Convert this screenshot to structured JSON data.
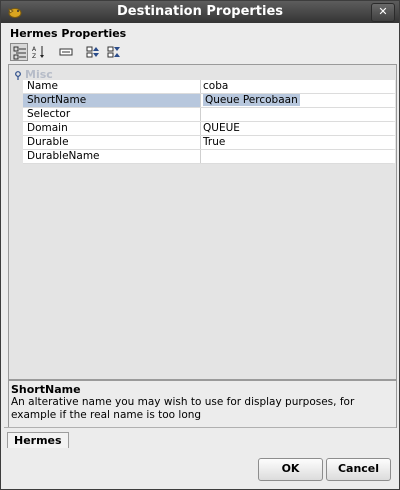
{
  "window": {
    "title": "Destination Properties",
    "close_label": "✕"
  },
  "heading": "Hermes Properties",
  "toolbar": {
    "buttons": [
      {
        "name": "categorized-view-icon",
        "active": true
      },
      {
        "name": "sort-alphabetical-icon",
        "active": false
      },
      {
        "name": "property-editor-icon",
        "active": false
      },
      {
        "name": "move-up-icon",
        "active": false
      },
      {
        "name": "move-down-icon",
        "active": false
      }
    ]
  },
  "category": {
    "label": "Misc"
  },
  "properties": [
    {
      "name": "Name",
      "value": "coba"
    },
    {
      "name": "ShortName",
      "value": "Queue Percobaan"
    },
    {
      "name": "Selector",
      "value": ""
    },
    {
      "name": "Domain",
      "value": "QUEUE"
    },
    {
      "name": "Durable",
      "value": "True"
    },
    {
      "name": "DurableName",
      "value": ""
    }
  ],
  "selected_index": 1,
  "description": {
    "title": "ShortName",
    "text": "An alterative name you may wish to use for display purposes, for example if the real name is too long"
  },
  "tabs": [
    {
      "label": "Hermes"
    }
  ],
  "buttons": {
    "ok": "OK",
    "cancel": "Cancel"
  }
}
